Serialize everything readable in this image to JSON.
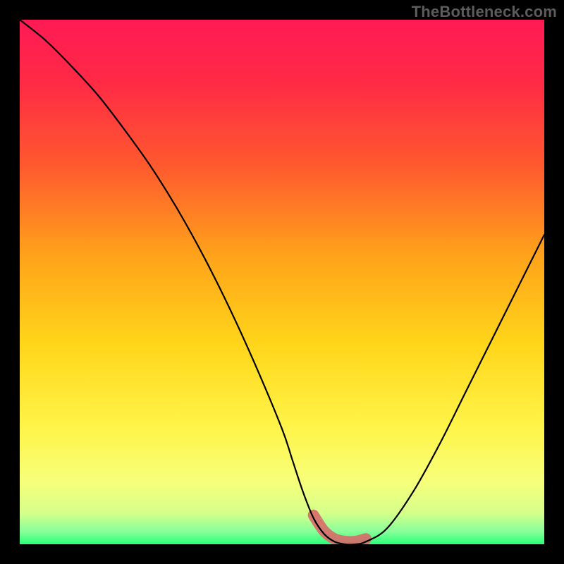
{
  "watermark": "TheBottleneck.com",
  "colors": {
    "background": "#000000",
    "gradient_stops": [
      {
        "offset": 0.0,
        "color": "#ff1a55"
      },
      {
        "offset": 0.12,
        "color": "#ff2a45"
      },
      {
        "offset": 0.28,
        "color": "#ff5a2e"
      },
      {
        "offset": 0.45,
        "color": "#ffa31a"
      },
      {
        "offset": 0.62,
        "color": "#ffd61a"
      },
      {
        "offset": 0.78,
        "color": "#fff54a"
      },
      {
        "offset": 0.88,
        "color": "#f7ff7a"
      },
      {
        "offset": 0.94,
        "color": "#d6ff8a"
      },
      {
        "offset": 0.975,
        "color": "#8aff9a"
      },
      {
        "offset": 1.0,
        "color": "#2aff7a"
      }
    ],
    "curve_line": "#000000",
    "highlight_stroke": "#d86a6a",
    "highlight_fill": "rgba(216,106,106,0.4)"
  },
  "chart_data": {
    "type": "line",
    "title": "",
    "xlabel": "",
    "ylabel": "",
    "xlim": [
      0,
      100
    ],
    "ylim": [
      0,
      100
    ],
    "grid": false,
    "legend": false,
    "series": [
      {
        "name": "bottleneck-curve",
        "x": [
          0,
          5,
          10,
          15,
          20,
          25,
          30,
          35,
          40,
          45,
          50,
          52,
          54,
          56,
          58,
          60,
          62,
          64,
          66,
          70,
          75,
          80,
          85,
          90,
          95,
          100
        ],
        "values": [
          100,
          96,
          91,
          85.5,
          79,
          72,
          64,
          55,
          45,
          34,
          22,
          16,
          10,
          5,
          2,
          0.5,
          0,
          0,
          0.5,
          3,
          10,
          19,
          29,
          39,
          49,
          59
        ]
      }
    ],
    "annotations": [
      {
        "name": "optimal-range",
        "x_start": 55,
        "x_end": 68,
        "note": "highlighted low-bottleneck region at curve bottom"
      }
    ]
  }
}
